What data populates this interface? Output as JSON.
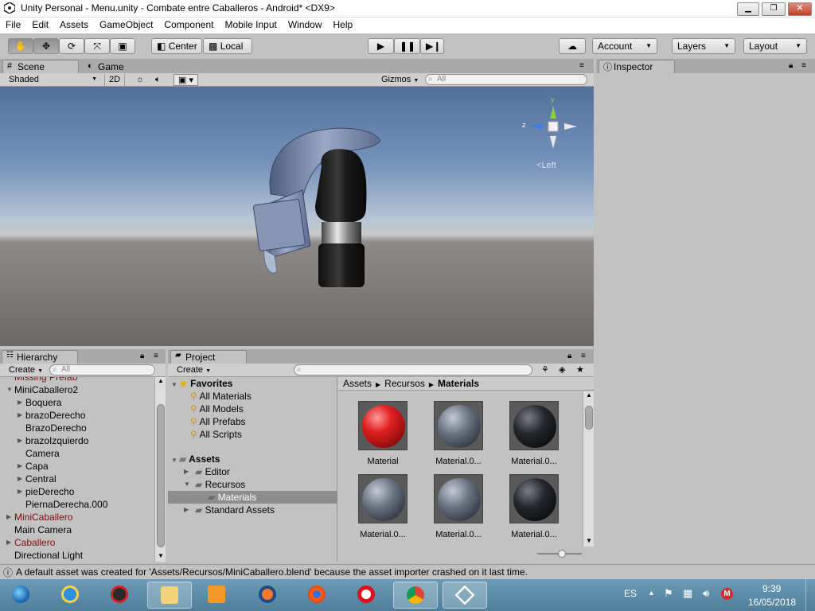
{
  "window": {
    "title": "Unity Personal - Menu.unity - Combate entre Caballeros - Android* <DX9>"
  },
  "menu": [
    "File",
    "Edit",
    "Assets",
    "GameObject",
    "Component",
    "Mobile Input",
    "Window",
    "Help"
  ],
  "toolbar": {
    "pivot": "Center",
    "space": "Local",
    "account": "Account",
    "layers": "Layers",
    "layout": "Layout"
  },
  "scene": {
    "tab_scene": "Scene",
    "tab_game": "Game",
    "shading": "Shaded",
    "mode_2d": "2D",
    "gizmos": "Gizmos",
    "search_placeholder": "All",
    "gizmo": {
      "y": "y",
      "z": "z",
      "view": "Left"
    }
  },
  "inspector": {
    "tab": "Inspector"
  },
  "hierarchy": {
    "tab": "Hierarchy",
    "create": "Create",
    "search_placeholder": "All",
    "items": [
      {
        "label": "Missing Prefab",
        "indent": 0,
        "arrow": "",
        "color": "#7a1010"
      },
      {
        "label": "MiniCaballero2",
        "indent": 0,
        "arrow": "▼",
        "color": "#000000"
      },
      {
        "label": "Boquera",
        "indent": 1,
        "arrow": "▶",
        "color": "#000000"
      },
      {
        "label": "brazoDerecho",
        "indent": 1,
        "arrow": "▶",
        "color": "#000000"
      },
      {
        "label": "BrazoDerecho",
        "indent": 1,
        "arrow": "",
        "color": "#000000"
      },
      {
        "label": "brazoIzquierdo",
        "indent": 1,
        "arrow": "▶",
        "color": "#000000"
      },
      {
        "label": "Camera",
        "indent": 1,
        "arrow": "",
        "color": "#000000"
      },
      {
        "label": "Capa",
        "indent": 1,
        "arrow": "▶",
        "color": "#000000"
      },
      {
        "label": "Central",
        "indent": 1,
        "arrow": "▶",
        "color": "#000000"
      },
      {
        "label": "pieDerecho",
        "indent": 1,
        "arrow": "▶",
        "color": "#000000"
      },
      {
        "label": "PiernaDerecha.000",
        "indent": 1,
        "arrow": "",
        "color": "#000000"
      },
      {
        "label": "MiniCaballero",
        "indent": 0,
        "arrow": "▶",
        "color": "#7a1010"
      },
      {
        "label": "Main Camera",
        "indent": 0,
        "arrow": "",
        "color": "#000000"
      },
      {
        "label": "Caballero",
        "indent": 0,
        "arrow": "▶",
        "color": "#7a1010"
      },
      {
        "label": "Directional Light",
        "indent": 0,
        "arrow": "",
        "color": "#000000"
      }
    ]
  },
  "project": {
    "tab": "Project",
    "create": "Create",
    "favorites_label": "Favorites",
    "favorites": [
      "All Materials",
      "All Models",
      "All Prefabs",
      "All Scripts"
    ],
    "assets_label": "Assets",
    "folders": [
      {
        "label": "Editor",
        "indent": 1,
        "arrow": "▶"
      },
      {
        "label": "Recursos",
        "indent": 1,
        "arrow": "▼"
      },
      {
        "label": "Materials",
        "indent": 2,
        "arrow": ""
      },
      {
        "label": "Standard Assets",
        "indent": 1,
        "arrow": "▶"
      }
    ],
    "breadcrumb": [
      "Assets",
      "Recursos",
      "Materials"
    ],
    "materials": [
      {
        "label": "Material",
        "color": "red"
      },
      {
        "label": "Material.0...",
        "color": "grey"
      },
      {
        "label": "Material.0...",
        "color": "black"
      },
      {
        "label": "Material.0...",
        "color": "grey"
      },
      {
        "label": "Material.0...",
        "color": "grey"
      },
      {
        "label": "Material.0...",
        "color": "black"
      }
    ]
  },
  "status": {
    "message": "A default asset was created for 'Assets/Recursos/MiniCaballero.blend' because the asset importer crashed on it last time."
  },
  "taskbar": {
    "language": "ES",
    "time": "9:39",
    "date": "16/05/2018"
  }
}
